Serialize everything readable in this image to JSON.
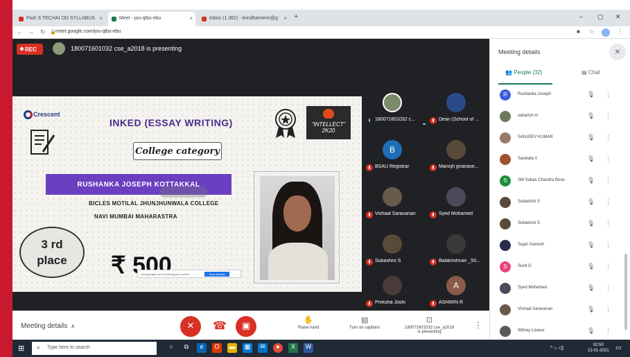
{
  "browser": {
    "tabs": [
      {
        "label": "Fwd: 6 TECHAI OD SYLLABUS",
        "color": "#d93025"
      },
      {
        "label": "Meet - jou-qtbs-ebu",
        "color": "#1a7a4c"
      },
      {
        "label": "Inbox (1,362) - krindhamerin@g",
        "color": "#d93025"
      }
    ],
    "url": "meet.google.com/jou-qtbs-ebu"
  },
  "meet": {
    "rec_label": "REC",
    "presenting_text": "180071601032 cse_a2018 is presenting",
    "slide": {
      "logo_text": "Crescent",
      "title": "INKED (ESSAY WRITING)",
      "category": "College category",
      "winner_name": "RUSHANKA JOSEPH KOTTAKKAL",
      "college": "BICLES MOTILAL JHUNJHUNWALA COLLEGE",
      "city": "NAVI MUMBAI MAHARASTRA",
      "place_line1": "3 rd",
      "place_line2": "place",
      "prize": "₹ 500",
      "event_logo": "\"INTELLECT\"",
      "event_year": "2K20",
      "share_text": "meet.google.com is sharing your screen",
      "stop_sharing": "Stop sharing"
    },
    "tiles": [
      {
        "name": "180071601032 c...",
        "initial": "",
        "color": "#7a8a6a"
      },
      {
        "name": "Dean (School of ...",
        "initial": "",
        "color": "#2a4a8a"
      },
      {
        "name": "BSAU Registrar",
        "initial": "B",
        "color": "#1e6fb8"
      },
      {
        "name": "Manojh gnanase...",
        "initial": "",
        "color": "#5a4a3a"
      },
      {
        "name": "Vishaal Saravanan",
        "initial": "",
        "color": "#6a5a4a"
      },
      {
        "name": "Syed Mohamed",
        "initial": "",
        "color": "#4a4a5a"
      },
      {
        "name": "Subashini S",
        "initial": "",
        "color": "#5a4a3a"
      },
      {
        "name": "Balakrishnan _50...",
        "initial": "",
        "color": "#3a3a3a"
      },
      {
        "name": "Preksha Joshi",
        "initial": "",
        "color": "#4a3a3a"
      },
      {
        "name": "ASHWIN R",
        "initial": "A",
        "color": "#8a5a4a"
      }
    ],
    "controls": {
      "meeting_details": "Meeting details",
      "raise_hand": "Raise hand",
      "captions": "Turn on captions",
      "presenting_line1": "180071601032 cse_a2018",
      "presenting_line2": "is presenting"
    }
  },
  "panel": {
    "title": "Meeting details",
    "people_tab": "People (32)",
    "chat_tab": "Chat",
    "people": [
      {
        "name": "Rushanka Joseph",
        "initial": "R",
        "color": "#3b5bdb"
      },
      {
        "name": "sabarish m",
        "initial": "",
        "color": "#6a7a5a"
      },
      {
        "name": "SANJEEV KUMAR",
        "initial": "",
        "color": "#9a7a6a"
      },
      {
        "name": "Sasikala.V",
        "initial": "",
        "color": "#a0522d"
      },
      {
        "name": "SM Subas Chandra Bose",
        "initial": "S",
        "color": "#1e8e3e"
      },
      {
        "name": "Subashini S",
        "initial": "",
        "color": "#5a4a3a"
      },
      {
        "name": "Subashini S",
        "initial": "",
        "color": "#5a4a3a"
      },
      {
        "name": "Sujan Ganesh",
        "initial": "",
        "color": "#2a2a4a"
      },
      {
        "name": "Sunil G",
        "initial": "S",
        "color": "#e8457a"
      },
      {
        "name": "Syed Mohamed",
        "initial": "",
        "color": "#4a4a5a"
      },
      {
        "name": "Vishaal Saravanan",
        "initial": "",
        "color": "#6a5a4a"
      },
      {
        "name": "Witney Lisieux",
        "initial": "",
        "color": "#5a5a5a"
      }
    ]
  },
  "taskbar": {
    "search_placeholder": "Type here to search",
    "time": "02:50",
    "date": "12-01-2021"
  }
}
